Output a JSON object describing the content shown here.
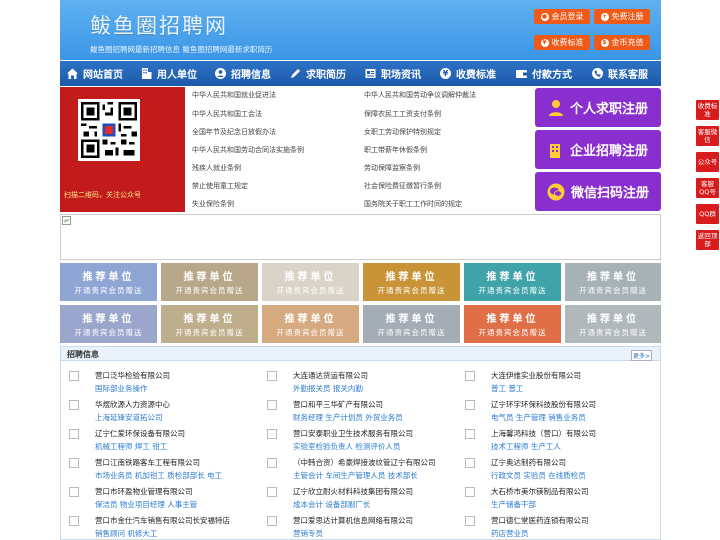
{
  "header": {
    "logo_title": "鲅鱼圈招聘网",
    "logo_subtitle": "鲅鱼圈招聘网最新招聘信息   鲅鱼圈招聘网最新求职简历",
    "buttons": [
      "会员登录",
      "免费注册",
      "收费标准",
      "金币充值"
    ]
  },
  "nav": [
    "网站首页",
    "用人单位",
    "招聘信息",
    "求职简历",
    "职场资讯",
    "收费标准",
    "付款方式",
    "联系客服"
  ],
  "banner": {
    "caption": "扫描二维码，关注公众号"
  },
  "links": {
    "left": [
      "中华人民共和国就业促进法",
      "中华人民共和国工会法",
      "全国年节及纪念日放假办法",
      "中华人民共和国劳动合同法实施条例",
      "残疾人就业条例",
      "禁止使用童工规定",
      "失业保险条例"
    ],
    "right": [
      "中华人民共和国劳动争议调解仲裁法",
      "保障农民工工资支付条例",
      "女职工劳动保护特别规定",
      "职工带薪年休假条例",
      "劳动保障监察条例",
      "社会保险费征缴暂行条例",
      "国务院关于职工工作时间的规定"
    ]
  },
  "register": [
    "个人求职注册",
    "企业招聘注册",
    "微信扫码注册"
  ],
  "promo": {
    "title": "推荐单位",
    "sub": "开通贵宾会员赠送",
    "colors": [
      "#8fa6d4",
      "#b8a889",
      "#d9d4c7",
      "#c99337",
      "#40a3a9",
      "#a6b2b6",
      "#9aa6cc",
      "#bfae8c",
      "#d5aa80",
      "#a4acb6",
      "#e06f47",
      "#b0b8bc"
    ]
  },
  "jobs": {
    "title": "招聘信息",
    "more": "更多>",
    "entries": [
      {
        "company": "营口泛华检验有限公司",
        "jobs": "国际部业务操作"
      },
      {
        "company": "大连通达货运有限公司",
        "jobs": "外勤报关员 报关内勤"
      },
      {
        "company": "大连伊维实业股份有限公司",
        "jobs": "普工 普工"
      },
      {
        "company": "华煜欣源人力资源中心",
        "jobs": "上海延锋安道拓公司"
      },
      {
        "company": "营口和平三华矿产有限公司",
        "jobs": "财务经理 生产计划员 外贸业务员"
      },
      {
        "company": "辽宁环宇环保科技股份有限公司",
        "jobs": "电气员 生产管理 销售业务员"
      },
      {
        "company": "辽宁仁爱环保设备有限公司",
        "jobs": "机械工程师 焊工 钳工"
      },
      {
        "company": "营口安泰职业卫生技术服务有限公司",
        "jobs": "实验室检验负责人 检测评价人员"
      },
      {
        "company": "上海馨鸿科技（营口）有限公司",
        "jobs": "技术工程师 生产工人"
      },
      {
        "company": "营口江南铁路客车工程有限公司",
        "jobs": "市场业务员 机加钳工 质检部部长 电工"
      },
      {
        "company": "（中韩合资）希豪焊接波纹管辽宁有限公司",
        "jobs": "主管会计 车间生产管理人员 技术部长"
      },
      {
        "company": "辽宁奥达制药有限公司",
        "jobs": "行政文员 实验员 在线质检员"
      },
      {
        "company": "营口市环盈物业管理有限公司",
        "jobs": "保洁员 物业项目经理 人事主管"
      },
      {
        "company": "辽宁欣立耐火材料科技集团有限公司",
        "jobs": "成本会计 设备部副厂长"
      },
      {
        "company": "大石桥市美尔镁制品有限公司",
        "jobs": "生产储备干部"
      },
      {
        "company": "营口市金仕汽车销售有限公司长安福特店",
        "jobs": "销售顾问 机修大工"
      },
      {
        "company": "营口爱思达计算机信息网络有限公司",
        "jobs": "营销专员"
      },
      {
        "company": "营口德仁堂医药连锁有限公司",
        "jobs": "药店营业员"
      }
    ]
  },
  "sidebar": [
    "收费标准",
    "客服微信",
    "公众号",
    "客服QQ号",
    "QQ群",
    "返回顶部"
  ],
  "colors": {
    "nav": "#2465b6",
    "header": "#4aa2ec",
    "accent": "#ef5a18",
    "register": "#8a2fcf",
    "banner": "#c21b1b",
    "sidebar": "#d81b1b"
  }
}
